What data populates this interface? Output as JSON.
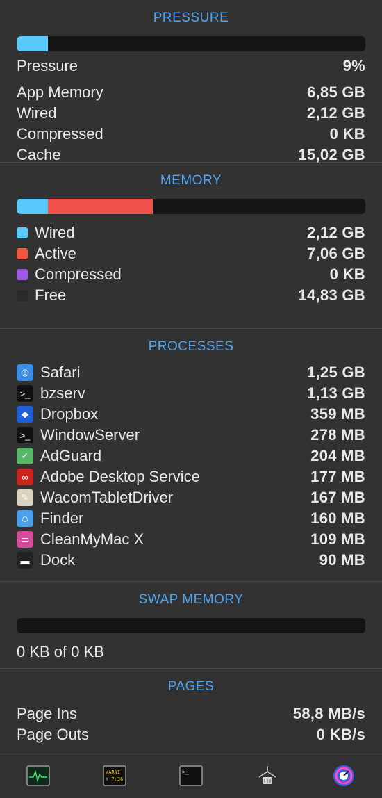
{
  "pressure": {
    "title": "PRESSURE",
    "fill_fraction": 0.09,
    "rows": [
      {
        "label": "Pressure",
        "value": "9%"
      },
      {
        "label": "App Memory",
        "value": "6,85 GB"
      },
      {
        "label": "Wired",
        "value": "2,12 GB"
      },
      {
        "label": "Compressed",
        "value": "0 KB"
      },
      {
        "label": "Cache",
        "value": "15,02 GB"
      }
    ]
  },
  "memory": {
    "title": "MEMORY",
    "segments": [
      {
        "name": "wired",
        "fraction": 0.09,
        "color": "#5ac8fa"
      },
      {
        "name": "active",
        "fraction": 0.3,
        "color": "#f0504a"
      }
    ],
    "rows": [
      {
        "label": "Wired",
        "value": "2,12 GB",
        "color": "#5ac8fa"
      },
      {
        "label": "Active",
        "value": "7,06 GB",
        "color": "#f05a3c"
      },
      {
        "label": "Compressed",
        "value": "0 KB",
        "color": "#9b59e6"
      },
      {
        "label": "Free",
        "value": "14,83 GB",
        "color": "#2a2a2a"
      }
    ]
  },
  "processes": {
    "title": "PROCESSES",
    "rows": [
      {
        "label": "Safari",
        "value": "1,25 GB",
        "icon": "safari-icon",
        "glyph": "◎",
        "bg": "#3a8ee6"
      },
      {
        "label": "bzserv",
        "value": "1,13 GB",
        "icon": "terminal-icon",
        "glyph": ">_",
        "bg": "#111111"
      },
      {
        "label": "Dropbox",
        "value": "359 MB",
        "icon": "dropbox-icon",
        "glyph": "◆",
        "bg": "#1f5fd6"
      },
      {
        "label": "WindowServer",
        "value": "278 MB",
        "icon": "terminal-icon",
        "glyph": ">_",
        "bg": "#111111"
      },
      {
        "label": "AdGuard",
        "value": "204 MB",
        "icon": "adguard-icon",
        "glyph": "✓",
        "bg": "#58b56a"
      },
      {
        "label": "Adobe Desktop Service",
        "value": "177 MB",
        "icon": "adobe-icon",
        "glyph": "∞",
        "bg": "#c8251f"
      },
      {
        "label": "WacomTabletDriver",
        "value": "167 MB",
        "icon": "wacom-icon",
        "glyph": "✎",
        "bg": "#d8d2c0"
      },
      {
        "label": "Finder",
        "value": "160 MB",
        "icon": "finder-icon",
        "glyph": "☺",
        "bg": "#4aa0ea"
      },
      {
        "label": "CleanMyMac X",
        "value": "109 MB",
        "icon": "cleanmymac-icon",
        "glyph": "▭",
        "bg": "#d74c9a"
      },
      {
        "label": "Dock",
        "value": "90 MB",
        "icon": "dock-icon",
        "glyph": "▬",
        "bg": "#222222"
      }
    ]
  },
  "swap": {
    "title": "SWAP MEMORY",
    "fill_fraction": 0,
    "summary": "0 KB of 0 KB"
  },
  "pages": {
    "title": "PAGES",
    "rows": [
      {
        "label": "Page Ins",
        "value": "58,8 MB/s"
      },
      {
        "label": "Page Outs",
        "value": "0 KB/s"
      }
    ]
  },
  "footer": {
    "console_text_1": "WARNI",
    "console_text_2": "Y 7:36",
    "terminal_text": ">_"
  }
}
